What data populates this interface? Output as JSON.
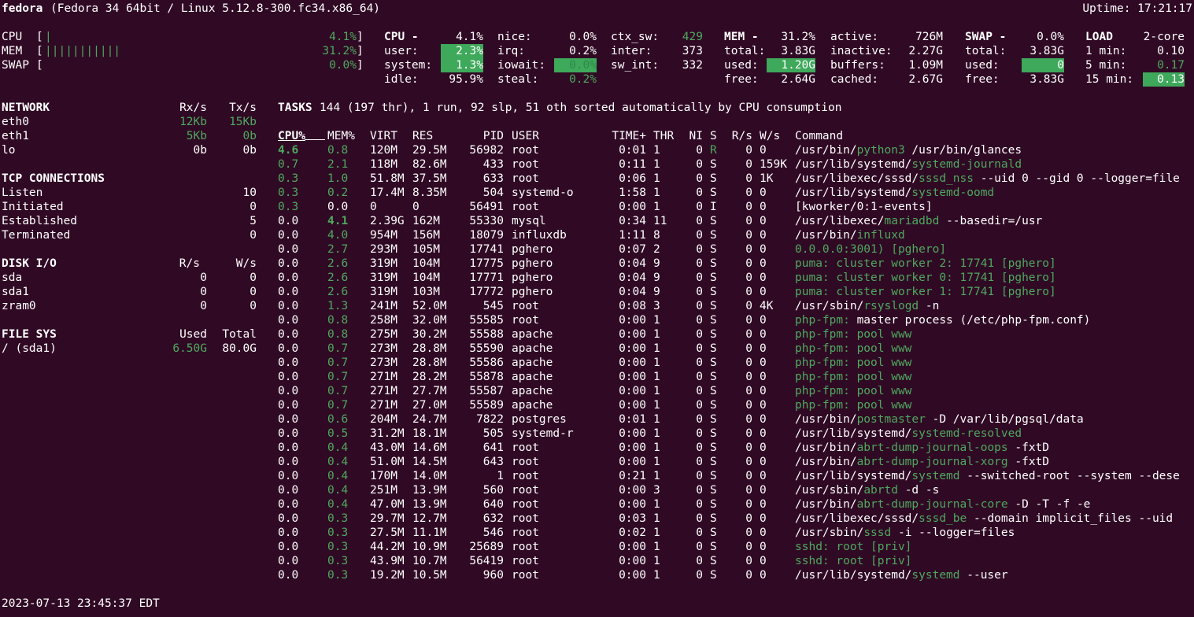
{
  "header": {
    "hostname": "fedora",
    "system": "(Fedora 34 64bit / Linux 5.12.8-300.fc34.x86_64)",
    "uptime": "Uptime: 17:21:17"
  },
  "quicklook": [
    {
      "label": "CPU",
      "bar": "|",
      "value": "4.1%"
    },
    {
      "label": "MEM",
      "bar": "|||||||||||",
      "value": "31.2%"
    },
    {
      "label": "SWAP",
      "bar": "",
      "value": "0.0%"
    }
  ],
  "cpu": {
    "title": "CPU -",
    "total": "4.1%",
    "user_l": "user:",
    "user": "2.3%",
    "system_l": "system:",
    "system": "1.3%",
    "idle_l": "idle:",
    "idle": "95.9%",
    "nice_l": "nice:",
    "nice": "0.0%",
    "irq_l": "irq:",
    "irq": "0.2%",
    "iowait_l": "iowait:",
    "iowait": "0.0%",
    "steal_l": "steal:",
    "steal": "0.2%",
    "ctx_l": "ctx_sw:",
    "ctx": "429",
    "inter_l": "inter:",
    "inter": "373",
    "swint_l": "sw_int:",
    "swint": "332"
  },
  "mem": {
    "title": "MEM -",
    "total_pct": "31.2%",
    "total_l": "total:",
    "total": "3.83G",
    "used_l": "used:",
    "used": "1.20G",
    "free_l": "free:",
    "free": "2.64G",
    "active_l": "active:",
    "active": "726M",
    "inactive_l": "inactive:",
    "inactive": "2.27G",
    "buffers_l": "buffers:",
    "buffers": "1.09M",
    "cached_l": "cached:",
    "cached": "2.67G"
  },
  "swap": {
    "title": "SWAP -",
    "pct": "0.0%",
    "total_l": "total:",
    "total": "3.83G",
    "used_l": "used:",
    "used": "0",
    "free_l": "free:",
    "free": "3.83G"
  },
  "load": {
    "title": "LOAD",
    "cores": "2-core",
    "m1_l": "1 min:",
    "m1": "0.10",
    "m5_l": "5 min:",
    "m5": "0.17",
    "m15_l": "15 min:",
    "m15": "0.13"
  },
  "network": {
    "title": "NETWORK",
    "rx": "Rx/s",
    "tx": "Tx/s",
    "rows": [
      {
        "name": "eth0",
        "rx": "12Kb",
        "tx": "15Kb",
        "hl": true
      },
      {
        "name": "eth1",
        "rx": "5Kb",
        "tx": "0b",
        "hl": true
      },
      {
        "name": "lo",
        "rx": "0b",
        "tx": "0b",
        "hl": false
      }
    ]
  },
  "tcp": {
    "title": "TCP CONNECTIONS",
    "rows": [
      {
        "name": "Listen",
        "value": "10"
      },
      {
        "name": "Initiated",
        "value": "0"
      },
      {
        "name": "Established",
        "value": "5"
      },
      {
        "name": "Terminated",
        "value": "0"
      }
    ]
  },
  "disk": {
    "title": "DISK I/O",
    "r": "R/s",
    "w": "W/s",
    "rows": [
      {
        "name": "sda",
        "r": "0",
        "w": "0"
      },
      {
        "name": "sda1",
        "r": "0",
        "w": "0"
      },
      {
        "name": "zram0",
        "r": "0",
        "w": "0"
      }
    ]
  },
  "fs": {
    "title": "FILE SYS",
    "used": "Used",
    "total": "Total",
    "rows": [
      {
        "name": "/ (sda1)",
        "used": "6.50G",
        "total": "80.0G"
      }
    ]
  },
  "tasks": {
    "label": "TASKS",
    "summary": "144 (197 thr), 1 run, 92 slp, 51 oth sorted automatically by CPU consumption"
  },
  "process_headers": {
    "cpu": "CPU%",
    "mem": "MEM%",
    "virt": "VIRT",
    "res": "RES",
    "pid": "PID",
    "user": "USER",
    "time": "TIME+",
    "thr": "THR",
    "ni": "NI",
    "s": "S",
    "rs": "R/s",
    "ws": "W/s",
    "cmd": "Command"
  },
  "processes": [
    {
      "cpu": "4.6",
      "mem": "0.8",
      "virt": "120M",
      "res": "29.5M",
      "pid": "56982",
      "user": "root",
      "time": "0:01",
      "thr": "1",
      "ni": "0",
      "s": "R",
      "rs": "0",
      "ws": "0",
      "cmd": [
        {
          "t": "/usr/bin/"
        },
        {
          "t": "python3",
          "g": 1
        },
        {
          "t": " /usr/bin/glances"
        }
      ]
    },
    {
      "cpu": "0.7",
      "mem": "2.1",
      "virt": "118M",
      "res": "82.6M",
      "pid": "433",
      "user": "root",
      "time": "0:11",
      "thr": "1",
      "ni": "0",
      "s": "S",
      "rs": "0",
      "ws": "159K",
      "cmd": [
        {
          "t": "/usr/lib/systemd/"
        },
        {
          "t": "systemd-journald",
          "g": 1
        }
      ]
    },
    {
      "cpu": "0.3",
      "mem": "1.0",
      "virt": "51.8M",
      "res": "37.5M",
      "pid": "633",
      "user": "root",
      "time": "0:06",
      "thr": "1",
      "ni": "0",
      "s": "S",
      "rs": "0",
      "ws": "1K",
      "cmd": [
        {
          "t": "/usr/libexec/sssd/"
        },
        {
          "t": "sssd_nss",
          "g": 1
        },
        {
          "t": " --uid 0 --gid 0 --logger=file"
        }
      ]
    },
    {
      "cpu": "0.3",
      "mem": "0.2",
      "virt": "17.4M",
      "res": "8.35M",
      "pid": "504",
      "user": "systemd-o",
      "time": "1:58",
      "thr": "1",
      "ni": "0",
      "s": "S",
      "rs": "0",
      "ws": "0",
      "cmd": [
        {
          "t": "/usr/lib/systemd/"
        },
        {
          "t": "systemd-oomd",
          "g": 1
        }
      ]
    },
    {
      "cpu": "0.3",
      "mem": "0.0",
      "virt": "0",
      "res": "0",
      "pid": "56491",
      "user": "root",
      "time": "0:00",
      "thr": "1",
      "ni": "0",
      "s": "I",
      "rs": "0",
      "ws": "0",
      "cmd": [
        {
          "t": "[kworker/0:1-events]"
        }
      ]
    },
    {
      "cpu": "0.0",
      "mem": "4.1",
      "virt": "2.39G",
      "res": "162M",
      "pid": "55330",
      "user": "mysql",
      "time": "0:34",
      "thr": "11",
      "ni": "0",
      "s": "S",
      "rs": "0",
      "ws": "0",
      "cmd": [
        {
          "t": "/usr/libexec/"
        },
        {
          "t": "mariadbd",
          "g": 1
        },
        {
          "t": " --basedir=/usr"
        }
      ]
    },
    {
      "cpu": "0.0",
      "mem": "4.0",
      "virt": "954M",
      "res": "156M",
      "pid": "18079",
      "user": "influxdb",
      "time": "1:11",
      "thr": "8",
      "ni": "0",
      "s": "S",
      "rs": "0",
      "ws": "0",
      "cmd": [
        {
          "t": "/usr/bin/"
        },
        {
          "t": "influxd",
          "g": 1
        }
      ]
    },
    {
      "cpu": "0.0",
      "mem": "2.7",
      "virt": "293M",
      "res": "105M",
      "pid": "17741",
      "user": "pghero",
      "time": "0:07",
      "thr": "2",
      "ni": "0",
      "s": "S",
      "rs": "0",
      "ws": "0",
      "cmd": [
        {
          "t": "0.0.0.0:3001) [pghero]",
          "g": 1
        }
      ]
    },
    {
      "cpu": "0.0",
      "mem": "2.6",
      "virt": "319M",
      "res": "104M",
      "pid": "17775",
      "user": "pghero",
      "time": "0:04",
      "thr": "9",
      "ni": "0",
      "s": "S",
      "rs": "0",
      "ws": "0",
      "cmd": [
        {
          "t": "puma: cluster worker 2: 17741 [pghero]",
          "g": 1
        }
      ]
    },
    {
      "cpu": "0.0",
      "mem": "2.6",
      "virt": "319M",
      "res": "104M",
      "pid": "17771",
      "user": "pghero",
      "time": "0:04",
      "thr": "9",
      "ni": "0",
      "s": "S",
      "rs": "0",
      "ws": "0",
      "cmd": [
        {
          "t": "puma: cluster worker 0: 17741 [pghero]",
          "g": 1
        }
      ]
    },
    {
      "cpu": "0.0",
      "mem": "2.6",
      "virt": "319M",
      "res": "103M",
      "pid": "17772",
      "user": "pghero",
      "time": "0:04",
      "thr": "9",
      "ni": "0",
      "s": "S",
      "rs": "0",
      "ws": "0",
      "cmd": [
        {
          "t": "puma: cluster worker 1: 17741 [pghero]",
          "g": 1
        }
      ]
    },
    {
      "cpu": "0.0",
      "mem": "1.3",
      "virt": "241M",
      "res": "52.0M",
      "pid": "545",
      "user": "root",
      "time": "0:08",
      "thr": "3",
      "ni": "0",
      "s": "S",
      "rs": "0",
      "ws": "4K",
      "cmd": [
        {
          "t": "/usr/sbin/"
        },
        {
          "t": "rsyslogd",
          "g": 1
        },
        {
          "t": " -n"
        }
      ]
    },
    {
      "cpu": "0.0",
      "mem": "0.8",
      "virt": "258M",
      "res": "32.0M",
      "pid": "55585",
      "user": "root",
      "time": "0:00",
      "thr": "1",
      "ni": "0",
      "s": "S",
      "rs": "0",
      "ws": "0",
      "cmd": [
        {
          "t": "php-fpm:",
          "g": 1
        },
        {
          "t": " master process (/etc/php-fpm.conf)"
        }
      ]
    },
    {
      "cpu": "0.0",
      "mem": "0.8",
      "virt": "275M",
      "res": "30.2M",
      "pid": "55588",
      "user": "apache",
      "time": "0:00",
      "thr": "1",
      "ni": "0",
      "s": "S",
      "rs": "0",
      "ws": "0",
      "cmd": [
        {
          "t": "php-fpm: pool www",
          "g": 1
        }
      ]
    },
    {
      "cpu": "0.0",
      "mem": "0.7",
      "virt": "273M",
      "res": "28.8M",
      "pid": "55590",
      "user": "apache",
      "time": "0:00",
      "thr": "1",
      "ni": "0",
      "s": "S",
      "rs": "0",
      "ws": "0",
      "cmd": [
        {
          "t": "php-fpm: pool www",
          "g": 1
        }
      ]
    },
    {
      "cpu": "0.0",
      "mem": "0.7",
      "virt": "273M",
      "res": "28.8M",
      "pid": "55586",
      "user": "apache",
      "time": "0:00",
      "thr": "1",
      "ni": "0",
      "s": "S",
      "rs": "0",
      "ws": "0",
      "cmd": [
        {
          "t": "php-fpm: pool www",
          "g": 1
        }
      ]
    },
    {
      "cpu": "0.0",
      "mem": "0.7",
      "virt": "271M",
      "res": "28.2M",
      "pid": "55878",
      "user": "apache",
      "time": "0:00",
      "thr": "1",
      "ni": "0",
      "s": "S",
      "rs": "0",
      "ws": "0",
      "cmd": [
        {
          "t": "php-fpm: pool www",
          "g": 1
        }
      ]
    },
    {
      "cpu": "0.0",
      "mem": "0.7",
      "virt": "271M",
      "res": "27.7M",
      "pid": "55587",
      "user": "apache",
      "time": "0:00",
      "thr": "1",
      "ni": "0",
      "s": "S",
      "rs": "0",
      "ws": "0",
      "cmd": [
        {
          "t": "php-fpm: pool www",
          "g": 1
        }
      ]
    },
    {
      "cpu": "0.0",
      "mem": "0.7",
      "virt": "271M",
      "res": "27.0M",
      "pid": "55589",
      "user": "apache",
      "time": "0:00",
      "thr": "1",
      "ni": "0",
      "s": "S",
      "rs": "0",
      "ws": "0",
      "cmd": [
        {
          "t": "php-fpm: pool www",
          "g": 1
        }
      ]
    },
    {
      "cpu": "0.0",
      "mem": "0.6",
      "virt": "204M",
      "res": "24.7M",
      "pid": "7822",
      "user": "postgres",
      "time": "0:01",
      "thr": "1",
      "ni": "0",
      "s": "S",
      "rs": "0",
      "ws": "0",
      "cmd": [
        {
          "t": "/usr/bin/"
        },
        {
          "t": "postmaster",
          "g": 1
        },
        {
          "t": " -D /var/lib/pgsql/data"
        }
      ]
    },
    {
      "cpu": "0.0",
      "mem": "0.5",
      "virt": "31.2M",
      "res": "18.1M",
      "pid": "505",
      "user": "systemd-r",
      "time": "0:00",
      "thr": "1",
      "ni": "0",
      "s": "S",
      "rs": "0",
      "ws": "0",
      "cmd": [
        {
          "t": "/usr/lib/systemd/"
        },
        {
          "t": "systemd-resolved",
          "g": 1
        }
      ]
    },
    {
      "cpu": "0.0",
      "mem": "0.4",
      "virt": "43.0M",
      "res": "14.6M",
      "pid": "641",
      "user": "root",
      "time": "0:00",
      "thr": "1",
      "ni": "0",
      "s": "S",
      "rs": "0",
      "ws": "0",
      "cmd": [
        {
          "t": "/usr/bin/"
        },
        {
          "t": "abrt-dump-journal-oops",
          "g": 1
        },
        {
          "t": " -fxtD"
        }
      ]
    },
    {
      "cpu": "0.0",
      "mem": "0.4",
      "virt": "51.0M",
      "res": "14.5M",
      "pid": "643",
      "user": "root",
      "time": "0:00",
      "thr": "1",
      "ni": "0",
      "s": "S",
      "rs": "0",
      "ws": "0",
      "cmd": [
        {
          "t": "/usr/bin/"
        },
        {
          "t": "abrt-dump-journal-xorg",
          "g": 1
        },
        {
          "t": " -fxtD"
        }
      ]
    },
    {
      "cpu": "0.0",
      "mem": "0.4",
      "virt": "170M",
      "res": "14.0M",
      "pid": "1",
      "user": "root",
      "time": "0:21",
      "thr": "1",
      "ni": "0",
      "s": "S",
      "rs": "0",
      "ws": "0",
      "cmd": [
        {
          "t": "/usr/lib/systemd/"
        },
        {
          "t": "systemd",
          "g": 1
        },
        {
          "t": " --switched-root --system --dese"
        }
      ]
    },
    {
      "cpu": "0.0",
      "mem": "0.4",
      "virt": "251M",
      "res": "13.9M",
      "pid": "560",
      "user": "root",
      "time": "0:00",
      "thr": "3",
      "ni": "0",
      "s": "S",
      "rs": "0",
      "ws": "0",
      "cmd": [
        {
          "t": "/usr/sbin/"
        },
        {
          "t": "abrtd",
          "g": 1
        },
        {
          "t": " -d -s"
        }
      ]
    },
    {
      "cpu": "0.0",
      "mem": "0.4",
      "virt": "47.0M",
      "res": "13.9M",
      "pid": "640",
      "user": "root",
      "time": "0:00",
      "thr": "1",
      "ni": "0",
      "s": "S",
      "rs": "0",
      "ws": "0",
      "cmd": [
        {
          "t": "/usr/bin/"
        },
        {
          "t": "abrt-dump-journal-core",
          "g": 1
        },
        {
          "t": " -D -T -f -e"
        }
      ]
    },
    {
      "cpu": "0.0",
      "mem": "0.3",
      "virt": "29.7M",
      "res": "12.7M",
      "pid": "632",
      "user": "root",
      "time": "0:03",
      "thr": "1",
      "ni": "0",
      "s": "S",
      "rs": "0",
      "ws": "0",
      "cmd": [
        {
          "t": "/usr/libexec/sssd/"
        },
        {
          "t": "sssd_be",
          "g": 1
        },
        {
          "t": " --domain implicit_files --uid"
        }
      ]
    },
    {
      "cpu": "0.0",
      "mem": "0.3",
      "virt": "27.5M",
      "res": "11.1M",
      "pid": "546",
      "user": "root",
      "time": "0:02",
      "thr": "1",
      "ni": "0",
      "s": "S",
      "rs": "0",
      "ws": "0",
      "cmd": [
        {
          "t": "/usr/sbin/"
        },
        {
          "t": "sssd",
          "g": 1
        },
        {
          "t": " -i --logger=files"
        }
      ]
    },
    {
      "cpu": "0.0",
      "mem": "0.3",
      "virt": "44.2M",
      "res": "10.9M",
      "pid": "25689",
      "user": "root",
      "time": "0:00",
      "thr": "1",
      "ni": "0",
      "s": "S",
      "rs": "0",
      "ws": "0",
      "cmd": [
        {
          "t": "sshd: root [priv]",
          "g": 1
        }
      ]
    },
    {
      "cpu": "0.0",
      "mem": "0.3",
      "virt": "43.9M",
      "res": "10.7M",
      "pid": "56419",
      "user": "root",
      "time": "0:00",
      "thr": "1",
      "ni": "0",
      "s": "S",
      "rs": "0",
      "ws": "0",
      "cmd": [
        {
          "t": "sshd: root [priv]",
          "g": 1
        }
      ]
    },
    {
      "cpu": "0.0",
      "mem": "0.3",
      "virt": "19.2M",
      "res": "10.5M",
      "pid": "960",
      "user": "root",
      "time": "0:00",
      "thr": "1",
      "ni": "0",
      "s": "S",
      "rs": "0",
      "ws": "0",
      "cmd": [
        {
          "t": "/usr/lib/systemd/"
        },
        {
          "t": "systemd",
          "g": 1
        },
        {
          "t": " --user"
        }
      ]
    }
  ],
  "footer": {
    "datetime": "2023-07-13 23:45:37 EDT"
  }
}
